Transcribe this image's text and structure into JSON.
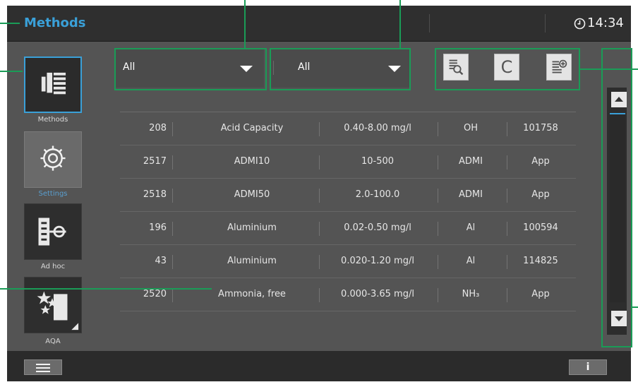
{
  "header": {
    "title": "Methods",
    "time": "14:34"
  },
  "sidebar": {
    "items": [
      {
        "label": "Methods",
        "icon": "method-list-icon",
        "active": true
      },
      {
        "label": "Settings",
        "icon": "gear-icon",
        "active": false
      },
      {
        "label": "Ad hoc",
        "icon": "adhoc-icon",
        "active": false
      },
      {
        "label": "AQA",
        "icon": "star-icon",
        "active": false
      }
    ]
  },
  "filters": {
    "filter1": "All",
    "filter2": "All"
  },
  "toolbar": {
    "icons": [
      "search-method-icon",
      "calibrate-icon",
      "method-info-icon"
    ],
    "calibrate_label": "C"
  },
  "table": {
    "rows": [
      {
        "id": "208",
        "name": "Acid Capacity",
        "range": "0.40-8.00 mg/l",
        "unit": "OH",
        "code": "101758"
      },
      {
        "id": "2517",
        "name": "ADMI10",
        "range": "10-500",
        "unit": "ADMI",
        "code": "App"
      },
      {
        "id": "2518",
        "name": "ADMI50",
        "range": "2.0-100.0",
        "unit": "ADMI",
        "code": "App"
      },
      {
        "id": "196",
        "name": "Aluminium",
        "range": "0.02-0.50 mg/l",
        "unit": "Al",
        "code": "100594"
      },
      {
        "id": "43",
        "name": "Aluminium",
        "range": "0.020-1.20 mg/l",
        "unit": "Al",
        "code": "114825"
      },
      {
        "id": "2520",
        "name": "Ammonia, free",
        "range": "0.000-3.65 mg/l",
        "unit": "NH₃",
        "code": "App"
      }
    ]
  },
  "footer": {
    "info_label": "i"
  },
  "colors": {
    "accent": "#3aa0d8",
    "callout": "#1a9c57",
    "background": "#545454",
    "bar": "#2f2f2f"
  }
}
